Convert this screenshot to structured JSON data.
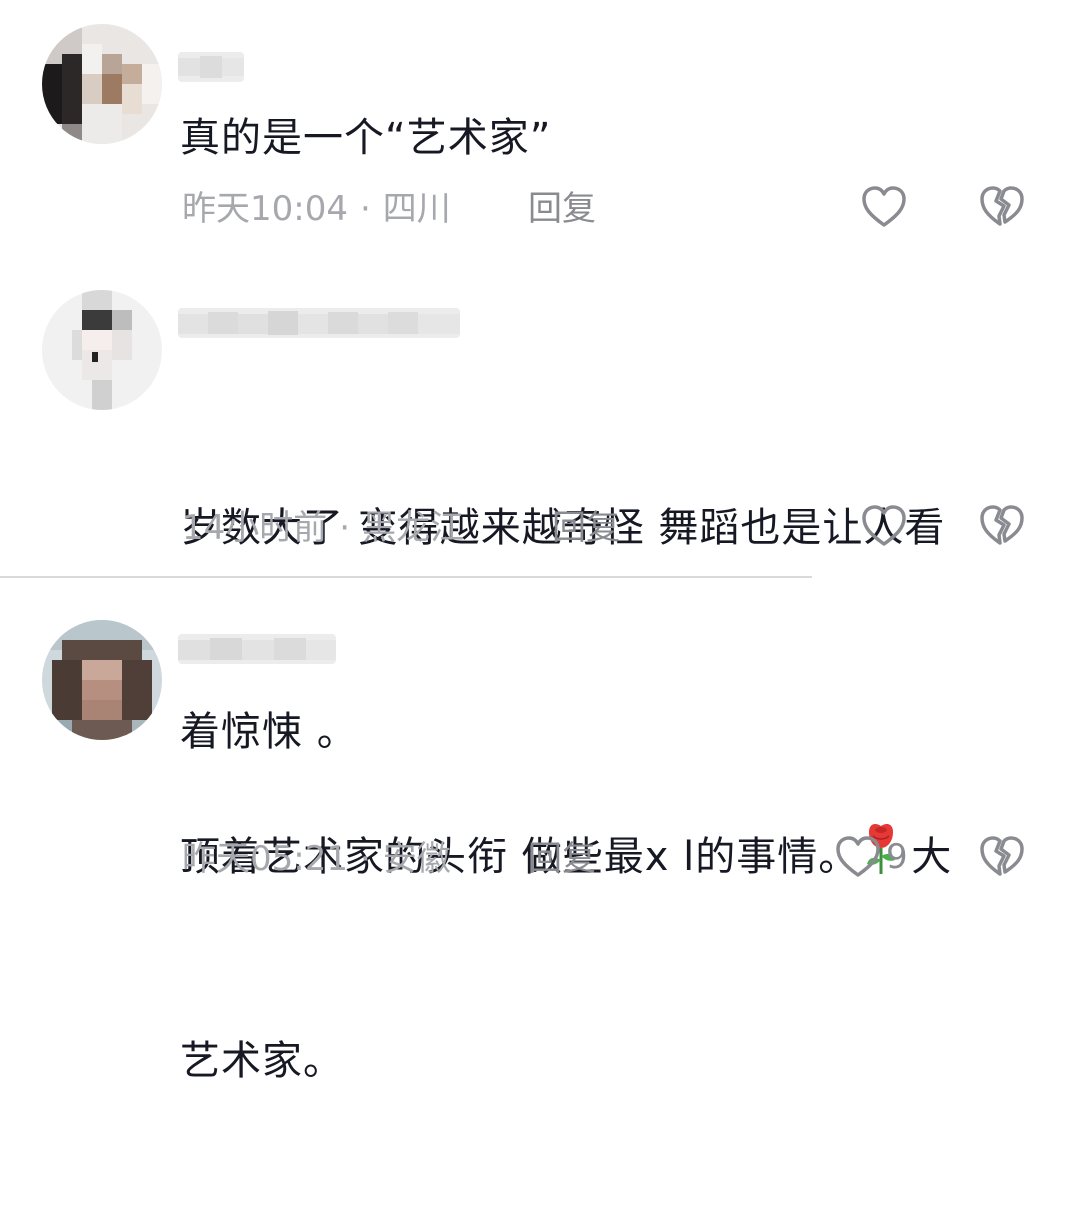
{
  "comments": [
    {
      "text": "真的是一个“艺术家”",
      "time": "昨天10:04",
      "separator": "·",
      "location": "四川",
      "reply_label": "回复",
      "like_icon": "heart-outline-icon",
      "dislike_icon": "broken-heart-icon"
    },
    {
      "text_line1": "岁数大了 变得越来越奇怪 舞蹈也是让人看",
      "text_line2": "着惊悚 。",
      "time": "14小时前",
      "separator": "·",
      "location": "黑龙江",
      "reply_label": "回复",
      "like_icon": "heart-outline-icon",
      "dislike_icon": "broken-heart-icon"
    },
    {
      "text_line1_a": "顶着艺术家的头衔 做些最x l的事情。",
      "text_line1_b": "大",
      "text_line2": "艺术家。",
      "emoji": "rose-icon",
      "time": "昨天05:21",
      "separator": "·",
      "location": "安徽",
      "reply_label": "回复",
      "like_count": "9",
      "like_icon": "heart-outline-icon",
      "dislike_icon": "broken-heart-icon"
    }
  ],
  "colors": {
    "text": "#161823",
    "meta": "#a6a8ad",
    "reply": "#8a8b91",
    "icon": "#8a8b91",
    "divider": "#dadada"
  }
}
